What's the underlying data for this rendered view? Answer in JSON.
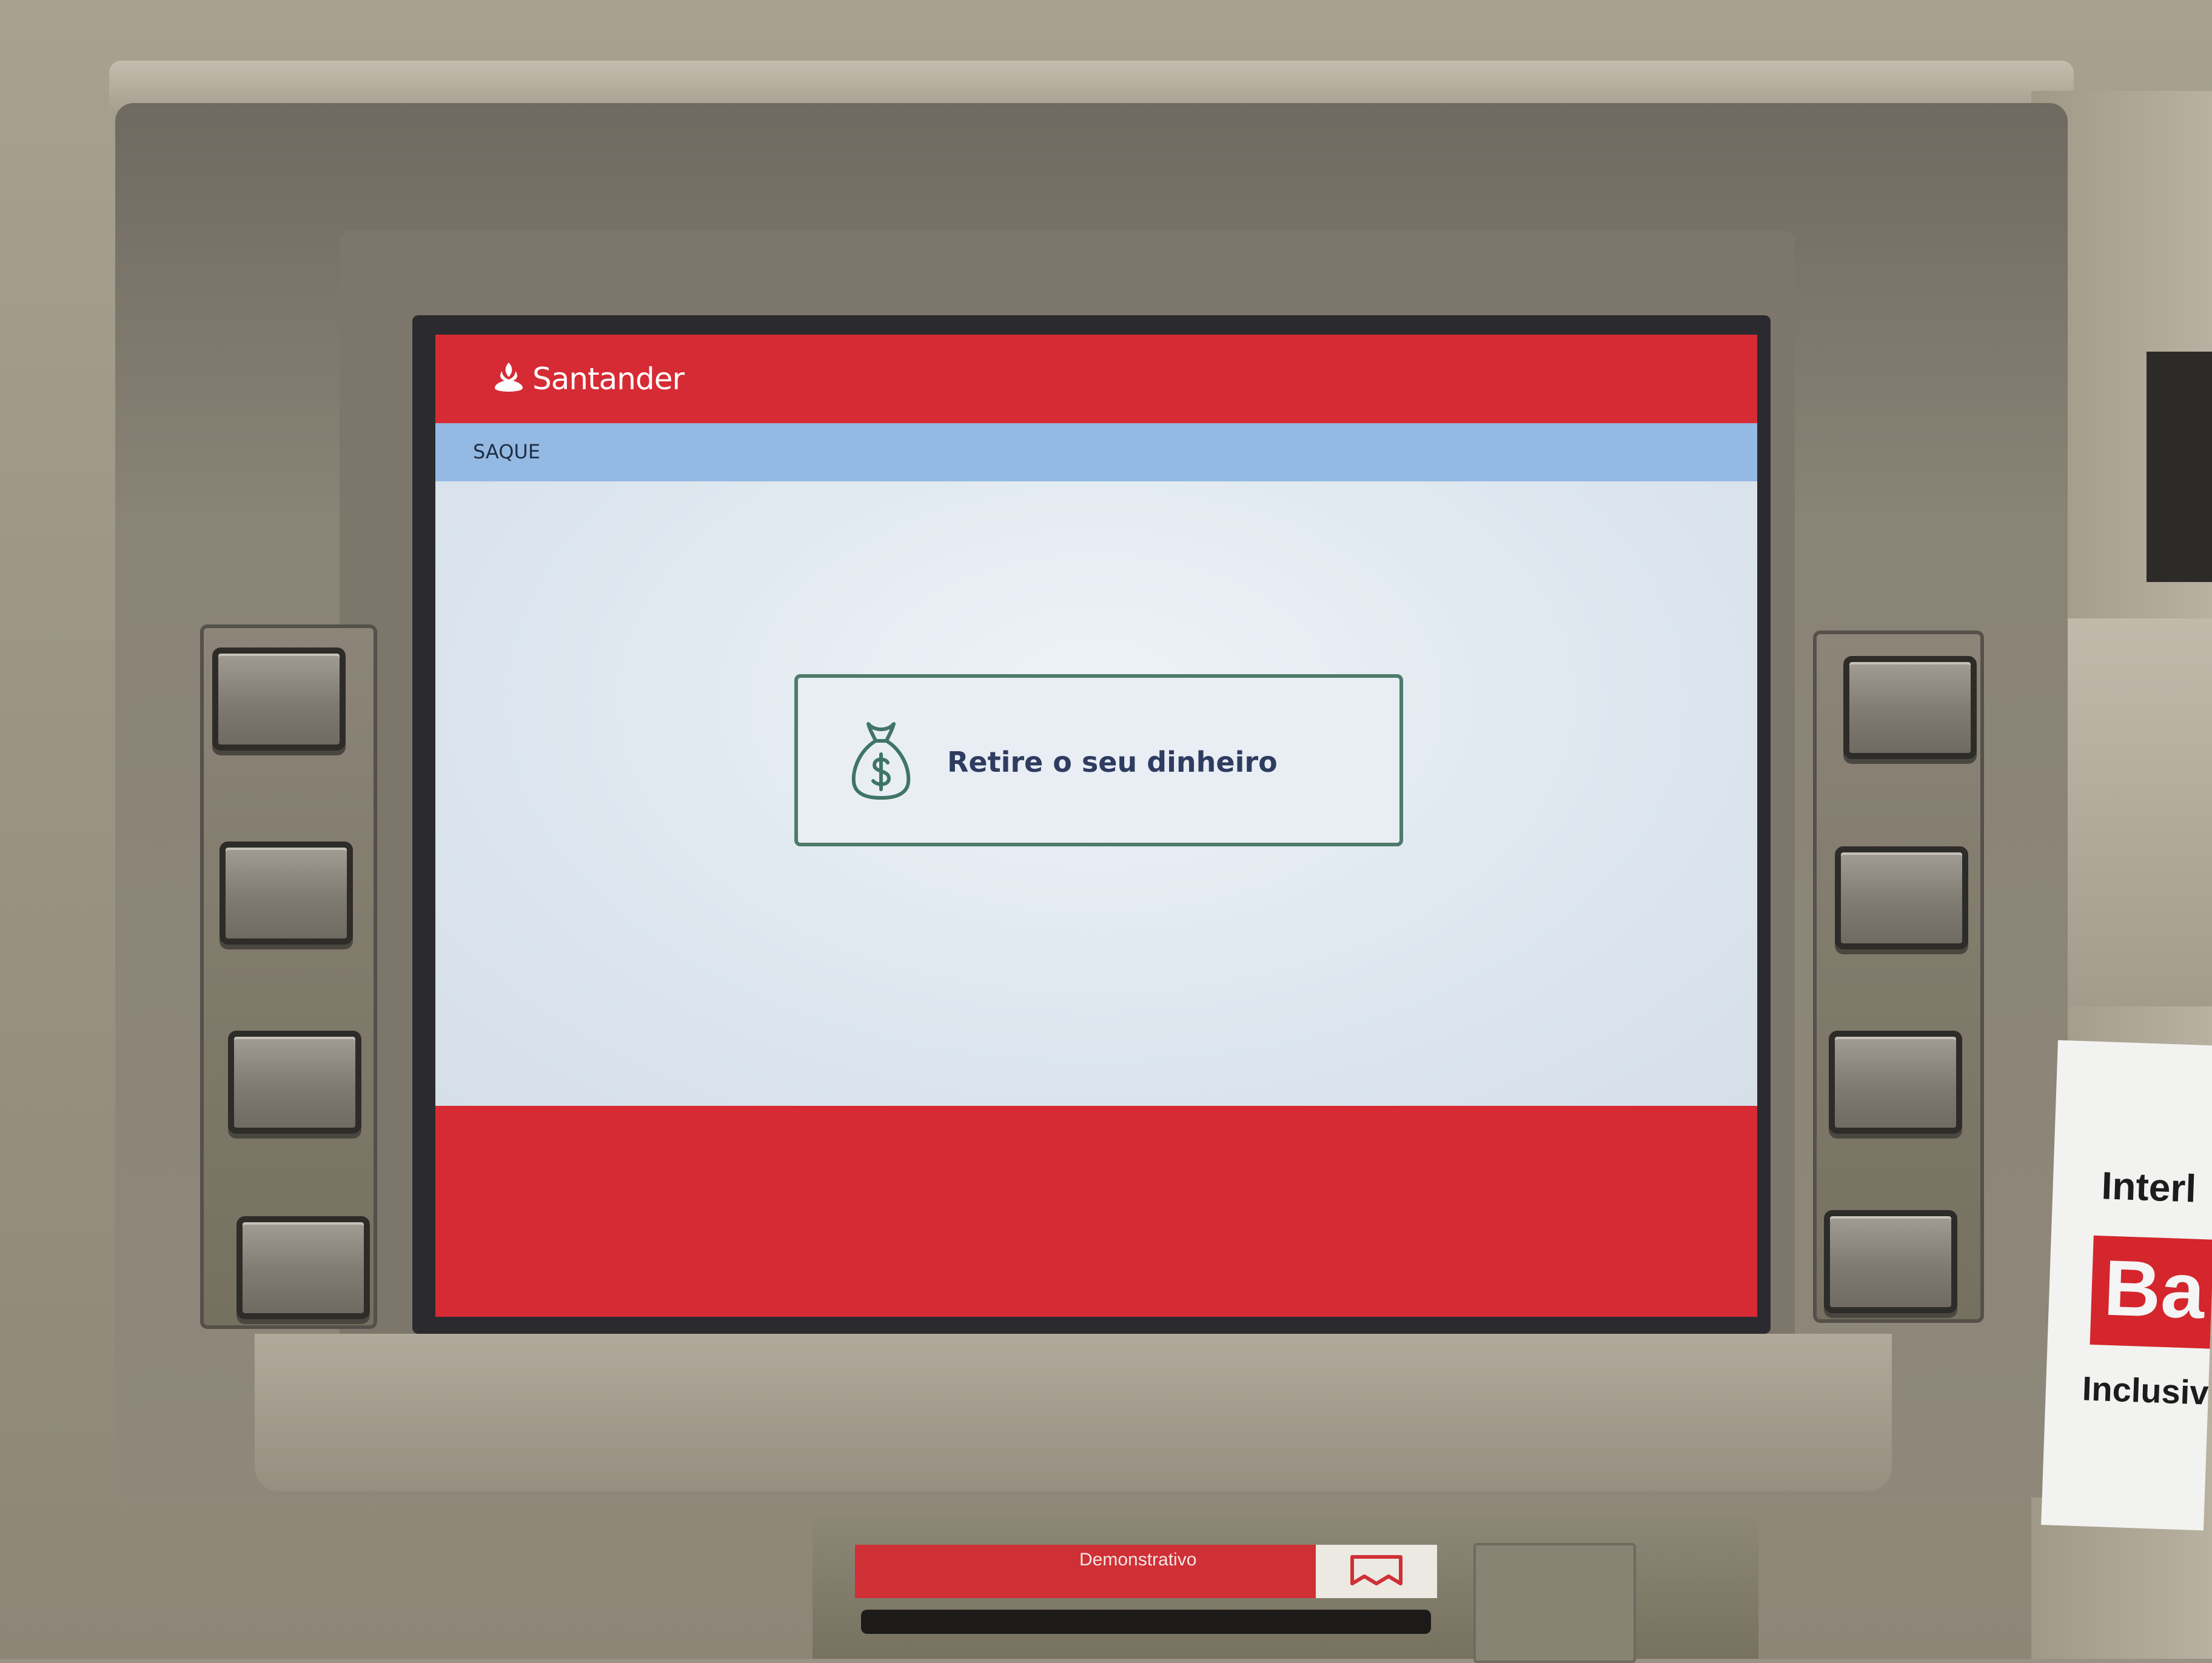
{
  "brand": {
    "name": "Santander",
    "color": "#d62b34"
  },
  "screen": {
    "title": "SAQUE",
    "message": "Retire o seu dinheiro",
    "message_icon": "money-bag-icon"
  },
  "sticker": {
    "line1": "Interl",
    "badge": "Ba",
    "line2": "Inclusiv"
  },
  "printer": {
    "label": "Demonstrativo"
  },
  "colors": {
    "title_bar": "#94b9e2",
    "content_bg": "#dfe7ef",
    "box_border": "#4e7a6a",
    "text": "#2e3c60"
  }
}
